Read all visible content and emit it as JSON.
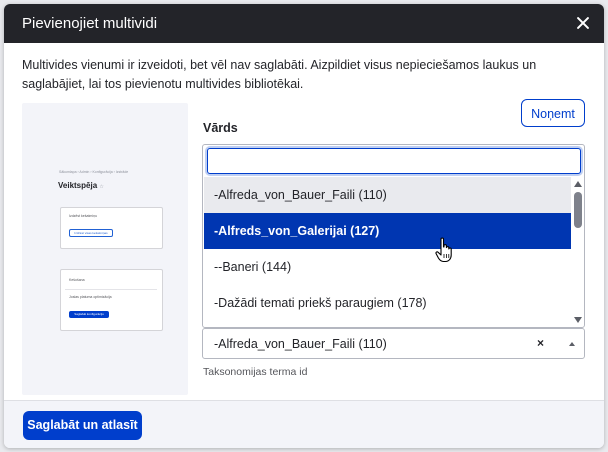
{
  "dialog": {
    "title": "Pievienojiet multividi",
    "close_icon": "close-icon"
  },
  "message": "Multivides vienumi ir izveidoti, bet vēl nav saglabāti. Aizpildiet visus nepieciešamos laukus un saglabājiet, lai tos pievienotu multivides bibliotēkai.",
  "preview": {
    "breadcrumb": "Sākumlapa › Admin › Konfigurācija › Izstrāde",
    "title": "Veiktspēja",
    "star_icon": "star-icon",
    "card1_title": "Izdzēst kešatmiņu",
    "card1_button": "Izdzēst visas kešatmiņas",
    "card2_row1": "Kešošana",
    "card2_row2": "Joslas platuma optimizācija",
    "card2_button": "Saglabāt konfigurāciju"
  },
  "remove_button": "Noņemt",
  "field": {
    "label": "Vārds",
    "search_value": "",
    "options": [
      "-Alfreda_von_Bauer_Faili (110)",
      "-Alfreds_von_Galerijai (127)",
      "--Baneri (144)",
      "-Dažādi temati priekš paraugiem (178)"
    ],
    "selected_value": "-Alfreda_von_Bauer_Faili (110)",
    "clear_label": "×",
    "help": "Taksonomijas terma id"
  },
  "footer": {
    "save_button": "Saglabāt un atlasīt"
  },
  "colors": {
    "titlebar": "#232429",
    "primary": "#003ecc",
    "selected_option": "#0036b1",
    "hover_option": "#e9eaee"
  }
}
